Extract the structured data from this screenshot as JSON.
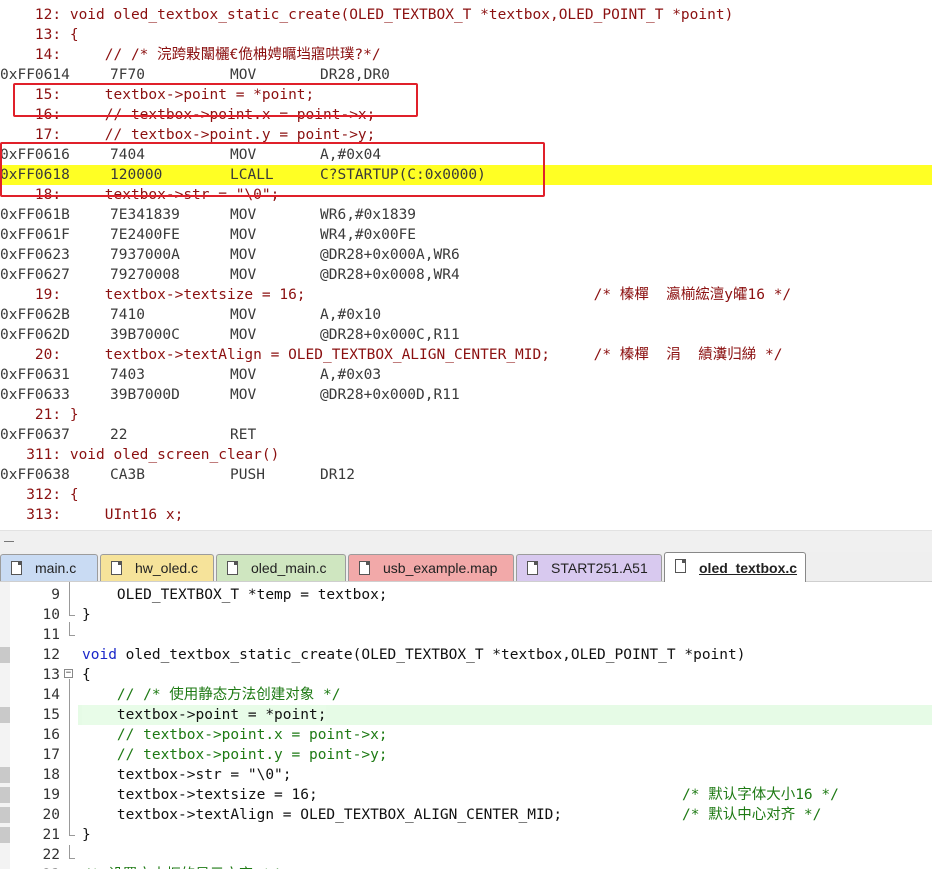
{
  "disassembly": {
    "lines": [
      {
        "kind": "src",
        "text": "    12: void oled_textbox_static_create(OLED_TEXTBOX_T *textbox,OLED_POINT_T *point)"
      },
      {
        "kind": "src",
        "text": "    13: {"
      },
      {
        "kind": "src",
        "text": "    14:     // /* 浣跨敤闈欐€佹柟娉曞垱寤哄璞?*/"
      },
      {
        "kind": "asm",
        "addr": "0xFF0614",
        "code": "7F70",
        "op": "MOV",
        "args": "DR28,DR0"
      },
      {
        "kind": "src",
        "text": "    15:     textbox->point = *point;"
      },
      {
        "kind": "src",
        "text": "    16:     // textbox->point.x = point->x;"
      },
      {
        "kind": "src",
        "text": "    17:     // textbox->point.y = point->y;"
      },
      {
        "kind": "asm",
        "addr": "0xFF0616",
        "code": "7404",
        "op": "MOV",
        "args": "A,#0x04"
      },
      {
        "kind": "asm",
        "addr": "0xFF0618",
        "code": "120000",
        "op": "LCALL",
        "args": "C?STARTUP(C:0x0000)",
        "highlight": true
      },
      {
        "kind": "src",
        "text": "    18:     textbox->str = \"\\0\";"
      },
      {
        "kind": "asm",
        "addr": "0xFF061B",
        "code": "7E341839",
        "op": "MOV",
        "args": "WR6,#0x1839"
      },
      {
        "kind": "asm",
        "addr": "0xFF061F",
        "code": "7E2400FE",
        "op": "MOV",
        "args": "WR4,#0x00FE"
      },
      {
        "kind": "asm",
        "addr": "0xFF0623",
        "code": "7937000A",
        "op": "MOV",
        "args": "@DR28+0x000A,WR6"
      },
      {
        "kind": "asm",
        "addr": "0xFF0627",
        "code": "79270008",
        "op": "MOV",
        "args": "@DR28+0x0008,WR4"
      },
      {
        "kind": "src",
        "text": "    19:     textbox->textsize = 16;                                 /* 榛樿  瀛椾綋澶у皬16 */"
      },
      {
        "kind": "asm",
        "addr": "0xFF062B",
        "code": "7410",
        "op": "MOV",
        "args": "A,#0x10"
      },
      {
        "kind": "asm",
        "addr": "0xFF062D",
        "code": "39B7000C",
        "op": "MOV",
        "args": "@DR28+0x000C,R11"
      },
      {
        "kind": "src",
        "text": "    20:     textbox->textAlign = OLED_TEXTBOX_ALIGN_CENTER_MID;     /* 榛樿  涓  績瀵归綈 */"
      },
      {
        "kind": "asm",
        "addr": "0xFF0631",
        "code": "7403",
        "op": "MOV",
        "args": "A,#0x03"
      },
      {
        "kind": "asm",
        "addr": "0xFF0633",
        "code": "39B7000D",
        "op": "MOV",
        "args": "@DR28+0x000D,R11"
      },
      {
        "kind": "src",
        "text": "    21: }"
      },
      {
        "kind": "asm",
        "addr": "0xFF0637",
        "code": "22",
        "op": "RET",
        "args": ""
      },
      {
        "kind": "src",
        "text": "   311: void oled_screen_clear()"
      },
      {
        "kind": "asm",
        "addr": "0xFF0638",
        "code": "CA3B",
        "op": "PUSH",
        "args": "DR12"
      },
      {
        "kind": "src",
        "text": "   312: {"
      },
      {
        "kind": "src",
        "text": "   313:     UInt16 x;"
      }
    ]
  },
  "tabs": [
    {
      "label": "main.c",
      "color": "#c9dbf3"
    },
    {
      "label": "hw_oled.c",
      "color": "#f6e39a"
    },
    {
      "label": "oled_main.c",
      "color": "#cfe6c0"
    },
    {
      "label": "usb_example.map",
      "color": "#f2a9a9"
    },
    {
      "label": "START251.A51",
      "color": "#d8c9ef"
    },
    {
      "label": "oled_textbox.c",
      "color": "#ffffff",
      "active": true
    }
  ],
  "editor": {
    "lines": [
      {
        "n": "9",
        "code": "    OLED_TEXTBOX_T *temp = textbox;"
      },
      {
        "n": "10",
        "code": "}"
      },
      {
        "n": "11",
        "code": ""
      },
      {
        "n": "12",
        "code": "void oled_textbox_static_create(OLED_TEXTBOX_T *textbox,OLED_POINT_T *point)",
        "marker": true
      },
      {
        "n": "13",
        "code": "{"
      },
      {
        "n": "14",
        "code": "    // /* 使用静态方法创建对象 */",
        "comment": true
      },
      {
        "n": "15",
        "code": "    textbox->point = *point;",
        "marker": true,
        "current": true
      },
      {
        "n": "16",
        "code": "    // textbox->point.x = point->x;",
        "comment": true
      },
      {
        "n": "17",
        "code": "    // textbox->point.y = point->y;",
        "comment": true
      },
      {
        "n": "18",
        "code": "    textbox->str = \"\\0\";",
        "marker": true
      },
      {
        "n": "19",
        "code": "    textbox->textsize = 16;",
        "trail": "/* 默认字体大小16 */",
        "marker": true
      },
      {
        "n": "20",
        "code": "    textbox->textAlign = OLED_TEXTBOX_ALIGN_CENTER_MID;",
        "trail": "/* 默认中心对齐 */",
        "marker": true
      },
      {
        "n": "21",
        "code": "}",
        "marker": true
      },
      {
        "n": "22",
        "code": ""
      },
      {
        "n": "23",
        "code": "/* 设置文本框的显示文字 */",
        "comment": true
      }
    ]
  }
}
